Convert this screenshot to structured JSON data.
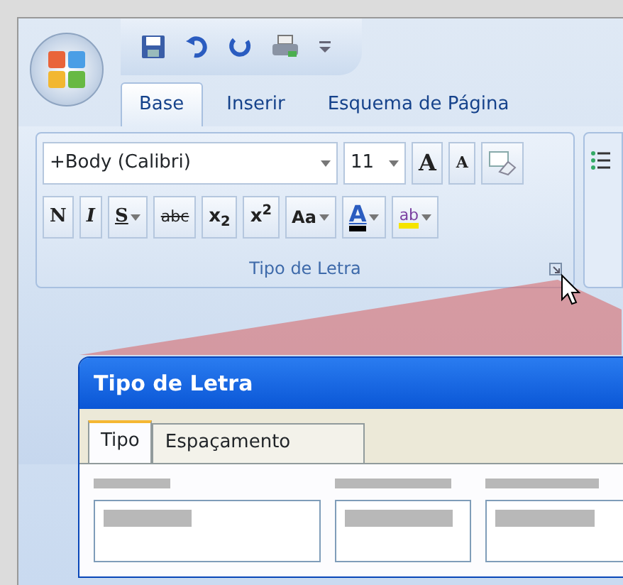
{
  "ribbon_tabs": [
    {
      "label": "Base",
      "selected": true
    },
    {
      "label": "Inserir",
      "selected": false
    },
    {
      "label": "Esquema de Página",
      "selected": false
    }
  ],
  "font_group": {
    "font_name": "+Body (Calibri)",
    "font_size": "11",
    "grow_label": "A",
    "shrink_label": "A",
    "format_buttons": [
      {
        "label": "N",
        "kind": "bold",
        "dropdown": false
      },
      {
        "label": "I",
        "kind": "italic",
        "dropdown": false
      },
      {
        "label": "S",
        "kind": "underline",
        "dropdown": true
      },
      {
        "label": "abc",
        "kind": "strike",
        "dropdown": false
      },
      {
        "label": "x$_{2}$",
        "kind": "plain",
        "dropdown": false
      },
      {
        "label": "x$^{2}$",
        "kind": "plain",
        "dropdown": false
      },
      {
        "label": "Aa",
        "kind": "case",
        "dropdown": true
      }
    ],
    "color_buttons": [
      {
        "label": "A",
        "kind": "font-color",
        "color": "#000000"
      },
      {
        "label": "ab",
        "kind": "highlight",
        "color": "#f5e400"
      }
    ],
    "group_label": "Tipo de Letra"
  },
  "dialog": {
    "title": "Tipo de Letra",
    "tabs": [
      {
        "label": "Tipo",
        "selected": true
      },
      {
        "label": "Espaçamento",
        "selected": false
      }
    ]
  }
}
